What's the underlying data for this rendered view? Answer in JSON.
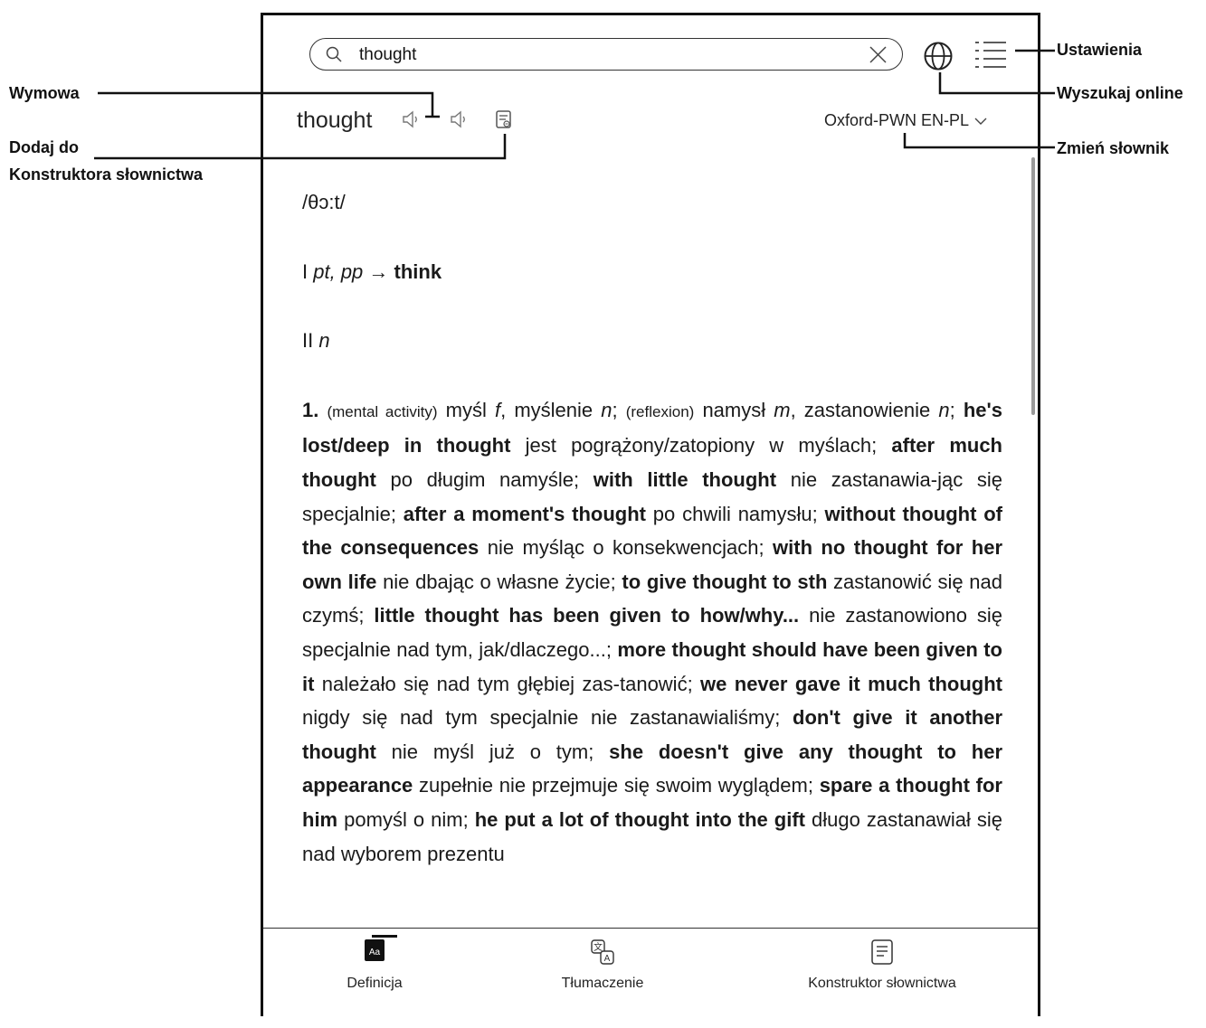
{
  "search": {
    "value": "thought"
  },
  "entry": {
    "headword": "thought",
    "dictionary": "Oxford-PWN EN-PL",
    "phonetic": "/θɔ:t/",
    "sense1": {
      "prefix": "I",
      "pos": "pt, pp",
      "arrow": "→",
      "ref": "think"
    },
    "sense2": {
      "prefix": "II",
      "pos": "n"
    }
  },
  "definition": [
    {
      "t": "1.",
      "s": "b"
    },
    {
      "t": " "
    },
    {
      "t": "(mental activity)",
      "s": "small"
    },
    {
      "t": " myśl "
    },
    {
      "t": "f",
      "s": "i"
    },
    {
      "t": ", myślenie "
    },
    {
      "t": "n",
      "s": "i"
    },
    {
      "t": "; "
    },
    {
      "t": "(reflexion)",
      "s": "small"
    },
    {
      "t": " namysł "
    },
    {
      "t": "m",
      "s": "i"
    },
    {
      "t": ", zastanowienie "
    },
    {
      "t": "n",
      "s": "i"
    },
    {
      "t": "; "
    },
    {
      "t": "he's lost/deep in thought",
      "s": "b"
    },
    {
      "t": " jest pogrążony/zatopiony w myślach; "
    },
    {
      "t": "after much thought",
      "s": "b"
    },
    {
      "t": " po długim namyśle; "
    },
    {
      "t": "with little thought",
      "s": "b"
    },
    {
      "t": " nie zastanawia-jąc się specjalnie; "
    },
    {
      "t": "after a moment's thought",
      "s": "b"
    },
    {
      "t": " po chwili namysłu; "
    },
    {
      "t": "without thought of the consequences",
      "s": "b"
    },
    {
      "t": " nie myśląc o konsekwencjach; "
    },
    {
      "t": "with no thought for her own life",
      "s": "b"
    },
    {
      "t": " nie dbając o własne życie; "
    },
    {
      "t": "to give thought to sth",
      "s": "b"
    },
    {
      "t": " zastanowić się nad czymś; "
    },
    {
      "t": "little thought has been given to how/why...",
      "s": "b"
    },
    {
      "t": " nie zastanowiono się specjalnie nad tym, jak/dlaczego...; "
    },
    {
      "t": "more thought should have been given to it",
      "s": "b"
    },
    {
      "t": " należało się nad tym głębiej zas-tanowić; "
    },
    {
      "t": "we never gave it much thought",
      "s": "b"
    },
    {
      "t": " nigdy się nad tym specjalnie nie zastanawialiśmy; "
    },
    {
      "t": "don't give it another thought",
      "s": "b"
    },
    {
      "t": " nie myśl już o tym; "
    },
    {
      "t": "she doesn't give any thought to her appearance",
      "s": "b"
    },
    {
      "t": " zupełnie nie przejmuje się swoim wyglądem; "
    },
    {
      "t": "spare a thought for him",
      "s": "b"
    },
    {
      "t": " pomyśl o nim; "
    },
    {
      "t": "he put a lot of thought into the gift",
      "s": "b"
    },
    {
      "t": " długo zastanawiał się nad wyborem prezentu"
    }
  ],
  "tabs": {
    "definition": "Definicja",
    "translation": "Tłumaczenie",
    "vocabulary": "Konstruktor słownictwa"
  },
  "annotations": {
    "settings": "Ustawienia",
    "search_online": "Wyszukaj online",
    "change_dictionary": "Zmień słownik",
    "pronunciation": "Wymowa",
    "add_to_vocab_line1": "Dodaj do",
    "add_to_vocab_line2": "Konstruktora słownictwa"
  },
  "icons": [
    "search-icon",
    "clear-icon",
    "globe-icon",
    "menu-icon",
    "speaker-icon",
    "vocab-add-icon",
    "chevron-down-icon",
    "definition-icon",
    "translation-icon",
    "vocabulary-icon"
  ]
}
